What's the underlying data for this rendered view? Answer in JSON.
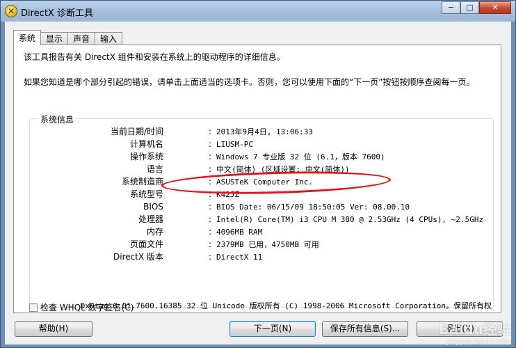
{
  "window": {
    "title": "DirectX 诊断工具",
    "caption": {
      "minimize": "−",
      "maximize": "□",
      "close": "✕"
    },
    "icon": "directx-x-icon"
  },
  "tabs": [
    {
      "label": "系统",
      "active": true
    },
    {
      "label": "显示",
      "active": false
    },
    {
      "label": "声音",
      "active": false
    },
    {
      "label": "输入",
      "active": false
    }
  ],
  "intro": {
    "line1": "该工具报告有关 DirectX 组件和安装在系统上的驱动程序的详细信息。",
    "line2": "如果您知道是哪个部分引起的错误，请单击上面适当的选项卡。否则，您可以使用下面的“下一页”按钮按顺序查阅每一页。"
  },
  "system_info": {
    "group_title": "系统信息",
    "rows": [
      {
        "label": "当前日期/时间",
        "value": "2013年9月4日, 13:06:33"
      },
      {
        "label": "计算机名",
        "value": "LIUSM-PC"
      },
      {
        "label": "操作系统",
        "value": "Windows 7 专业版 32 位 (6.1，版本 7600)"
      },
      {
        "label": "语言",
        "value": "中文(简体) (区域设置: 中文(简体))"
      },
      {
        "label": "系统制造商",
        "value": "ASUSTeK Computer Inc."
      },
      {
        "label": "系统型号",
        "value": "K42JZ"
      },
      {
        "label": "BIOS",
        "value": "BIOS Date: 06/15/09 18:50:05 Ver: 08.00.10"
      },
      {
        "label": "处理器",
        "value": "Intel(R) Core(TM) i3 CPU       M 380  @ 2.53GHz (4 CPUs), ~2.5GHz"
      },
      {
        "label": "内存",
        "value": "4096MB RAM"
      },
      {
        "label": "页面文件",
        "value": "2379MB 已用，4750MB 可用"
      },
      {
        "label": "DirectX 版本",
        "value": "DirectX 11"
      }
    ],
    "colon": ":"
  },
  "whql": {
    "label": "检查 WHQL 数字签名(C)",
    "checked": false
  },
  "copyright": "DxDiag 6.01.7600.16385 32 位 Unicode 版权所有 (C) 1998-2006 Microsoft Corporation。保留所有权",
  "buttons": {
    "help": "帮助(H)",
    "next": "下一页(N)",
    "save": "保存所有信息(S)...",
    "exit": "退出(X)"
  },
  "watermark": {
    "main": "Baidu经验",
    "sub": "jingyan.baidu.com"
  },
  "colors": {
    "highlight_ellipse": "#e0161b",
    "titlebar": "#a4bfdc"
  }
}
